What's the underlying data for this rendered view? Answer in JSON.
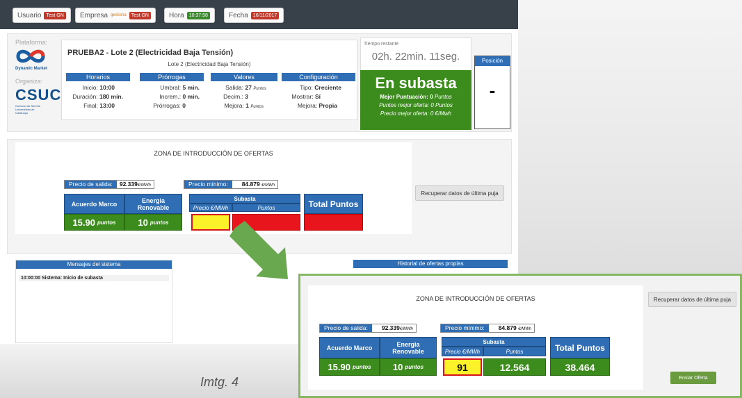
{
  "topbar": {
    "usuario_label": "Usuario",
    "usuario_value": "Test GN",
    "empresa_label": "Empresa",
    "empresa_logo_text": "gestiona",
    "empresa_value": "Test GN",
    "hora_label": "Hora",
    "hora_value": "10:37:58",
    "fecha_label": "Fecha",
    "fecha_value": "16/11/2017"
  },
  "org": {
    "plataforma_label": "Plataforma:",
    "platform_name": "Dynamic Market",
    "organiza_label": "Organiza:",
    "csuc_name": "CSUC",
    "csuc_sub": "Consorci de Serveis Universitaris de Catalunya"
  },
  "lot": {
    "title": "PRUEBA2 - Lote 2 (Electricidad Baja Tensión)",
    "subtitle": "Lote 2 (Electricidad Baja Tensión)",
    "headers": [
      "Horarios",
      "Prórrogas",
      "Valores",
      "Configuración"
    ],
    "horarios": [
      {
        "label": "Inicio:",
        "value": "10:00",
        "unit": ""
      },
      {
        "label": "Duración:",
        "value": "180 min.",
        "unit": ""
      },
      {
        "label": "Final:",
        "value": "13:00",
        "unit": ""
      }
    ],
    "prorrogas": [
      {
        "label": "Umbral:",
        "value": "5 min.",
        "unit": ""
      },
      {
        "label": "Increm.:",
        "value": "0 min.",
        "unit": ""
      },
      {
        "label": "Prórrogas:",
        "value": "0",
        "unit": ""
      }
    ],
    "valores": [
      {
        "label": "Salida:",
        "value": "27",
        "unit": "Puntos"
      },
      {
        "label": "Decim.:",
        "value": "3",
        "unit": ""
      },
      {
        "label": "Mejora:",
        "value": "1",
        "unit": "Puntos"
      }
    ],
    "configuracion": [
      {
        "label": "Tipo:",
        "value": "Creciente",
        "unit": ""
      },
      {
        "label": "Mostrar:",
        "value": "Sí",
        "unit": ""
      },
      {
        "label": "Mejora:",
        "value": "Propia",
        "unit": ""
      }
    ]
  },
  "timer": {
    "label": "Tiempo restante",
    "value": "02h. 22min. 11seg."
  },
  "status": {
    "title": "En subasta",
    "line1_label": "Mejor Puntuación:",
    "line1_value": "0",
    "line1_unit": "Puntos",
    "line2": "Puntos mejor oferta: 0 Puntos",
    "line3": "Precio mejor oferta: 0 €/Mwh"
  },
  "position": {
    "label": "Posición",
    "value": "-"
  },
  "offers": {
    "zone_title": "ZONA DE INTRODUCCIÓN DE OFERTAS",
    "precio_salida_label": "Precio de salida:",
    "precio_salida_value": "92.339",
    "precio_salida_unit": "€/MWh",
    "precio_minimo_label": "Precio mínimo:",
    "precio_minimo_value": "84.879",
    "precio_minimo_unit": "€/MWh",
    "col_acuerdo": "Acuerdo Marco",
    "col_energia": "Energia Renovable",
    "col_subasta": "Subasta",
    "col_precio": "Precio €/MWh",
    "col_puntos": "Puntos",
    "col_total": "Total Puntos",
    "acuerdo_value": "15.90",
    "energia_value": "10",
    "points_unit": "puntos",
    "recover_button": "Recuperar datos de última puja"
  },
  "messages": {
    "header": "Mensajes del sistema",
    "lines": [
      "10:00:00 Sistema: Inicio de subasta"
    ],
    "history_header": "Historial de ofertas propias"
  },
  "zoom": {
    "zone_title": "ZONA DE INTRODUCCIÓN DE OFERTAS",
    "precio_input": "91",
    "puntos_value": "12.564",
    "total_value": "38.464",
    "recover_button": "Recuperar datos de última puja",
    "send_button": "Enviar Oferta"
  },
  "caption": "Imtg. 4",
  "colors": {
    "header_blue": "#2f6eb4",
    "green": "#3b8c1c",
    "red": "#e8161c",
    "yellow": "#fbf22a",
    "topbar": "#38414a"
  }
}
